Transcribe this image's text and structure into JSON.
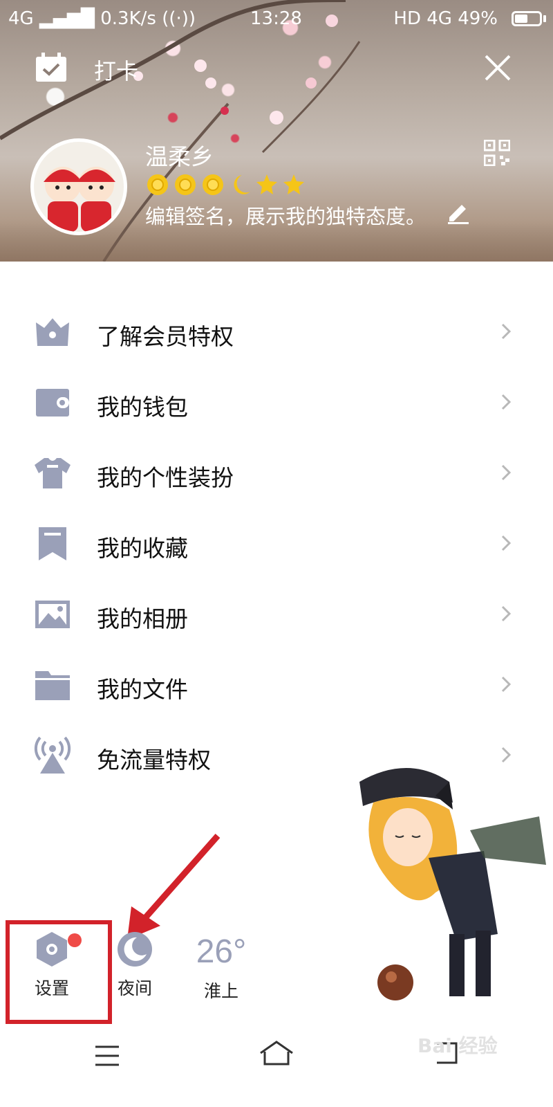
{
  "status_bar": {
    "network": "4G",
    "speed": "0.3K/s",
    "time": "13:28",
    "right": "HD 4G",
    "battery": "49%",
    "battery_level": 0.49
  },
  "header": {
    "checkin_label": "打卡",
    "username": "温柔乡",
    "signature": "编辑签名，展示我的独特态度。",
    "level_icons": [
      "sun-icon",
      "sun-icon",
      "sun-icon",
      "moon-icon",
      "star-icon",
      "star-icon"
    ]
  },
  "menu": {
    "items": [
      {
        "label": "了解会员特权",
        "icon": "crown-icon"
      },
      {
        "label": "我的钱包",
        "icon": "wallet-icon"
      },
      {
        "label": "我的个性装扮",
        "icon": "shirt-icon"
      },
      {
        "label": "我的收藏",
        "icon": "bookmark-icon"
      },
      {
        "label": "我的相册",
        "icon": "picture-icon"
      },
      {
        "label": "我的文件",
        "icon": "folder-icon"
      },
      {
        "label": "免流量特权",
        "icon": "signal-tower-icon"
      }
    ]
  },
  "bottom": {
    "settings_label": "设置",
    "night_label": "夜间",
    "temperature": "26°",
    "city": "淮上"
  },
  "watermark": "Bai 经验",
  "colors": {
    "icon_gray": "#9aa0b8",
    "accent_red": "#d2222a",
    "badge_red": "#ef4b47"
  }
}
